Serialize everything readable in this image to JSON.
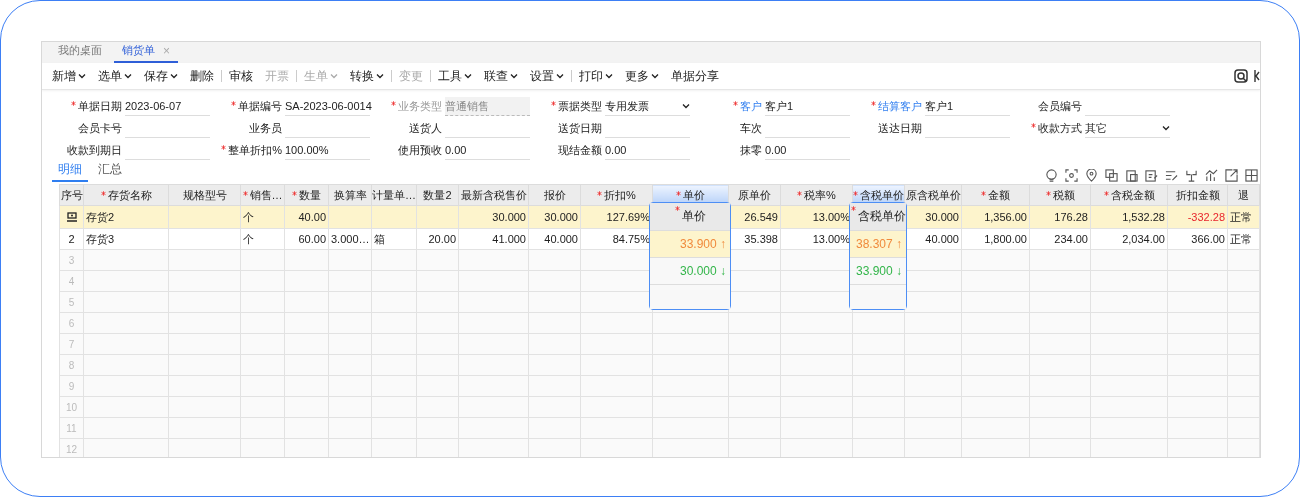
{
  "tabs": [
    {
      "label": "我的桌面",
      "selected": false,
      "closable": false
    },
    {
      "label": "销货单",
      "selected": true,
      "closable": true,
      "close_glyph": "×"
    }
  ],
  "toolbar": [
    {
      "kind": "button",
      "label": "新增",
      "dropdown": true,
      "disabled": false
    },
    {
      "kind": "button",
      "label": "选单",
      "dropdown": true,
      "disabled": false
    },
    {
      "kind": "button",
      "label": "保存",
      "dropdown": true,
      "disabled": false
    },
    {
      "kind": "button",
      "label": "删除",
      "dropdown": false,
      "disabled": false
    },
    {
      "kind": "separator"
    },
    {
      "kind": "button",
      "label": "审核",
      "dropdown": false,
      "disabled": false
    },
    {
      "kind": "button",
      "label": "开票",
      "dropdown": false,
      "disabled": true
    },
    {
      "kind": "separator"
    },
    {
      "kind": "button",
      "label": "生单",
      "dropdown": true,
      "disabled": true
    },
    {
      "kind": "button",
      "label": "转换",
      "dropdown": true,
      "disabled": false
    },
    {
      "kind": "separator"
    },
    {
      "kind": "button",
      "label": "变更",
      "dropdown": false,
      "disabled": true
    },
    {
      "kind": "separator"
    },
    {
      "kind": "button",
      "label": "工具",
      "dropdown": true,
      "disabled": false
    },
    {
      "kind": "button",
      "label": "联查",
      "dropdown": true,
      "disabled": false
    },
    {
      "kind": "button",
      "label": "设置",
      "dropdown": true,
      "disabled": false
    },
    {
      "kind": "separator"
    },
    {
      "kind": "button",
      "label": "打印",
      "dropdown": true,
      "disabled": false
    },
    {
      "kind": "button",
      "label": "更多",
      "dropdown": true,
      "disabled": false
    },
    {
      "kind": "button",
      "label": "单据分享",
      "dropdown": false,
      "disabled": false
    }
  ],
  "form_fields": [
    {
      "label": "单据日期",
      "required": true,
      "link": false,
      "disabled": false,
      "dropdown": false,
      "value": "2023-06-07"
    },
    {
      "label": "单据编号",
      "required": true,
      "link": false,
      "disabled": false,
      "dropdown": false,
      "value": "SA-2023-06-0014"
    },
    {
      "label": "业务类型",
      "required": true,
      "link": false,
      "disabled": true,
      "dropdown": false,
      "value": "普通销售"
    },
    {
      "label": "票据类型",
      "required": true,
      "link": false,
      "disabled": false,
      "dropdown": true,
      "value": "专用发票"
    },
    {
      "label": "客户",
      "required": true,
      "link": true,
      "disabled": false,
      "dropdown": false,
      "value": "客户1"
    },
    {
      "label": "结算客户",
      "required": true,
      "link": true,
      "disabled": false,
      "dropdown": false,
      "value": "客户1"
    },
    {
      "label": "会员编号",
      "required": false,
      "link": false,
      "disabled": false,
      "dropdown": false
    },
    {
      "label": "会员卡号",
      "required": false,
      "link": false,
      "disabled": false,
      "dropdown": false
    },
    {
      "label": "业务员",
      "required": false,
      "link": false,
      "disabled": false,
      "dropdown": false
    },
    {
      "label": "送货人",
      "required": false,
      "link": false,
      "disabled": false,
      "dropdown": false
    },
    {
      "label": "送货日期",
      "required": false,
      "link": false,
      "disabled": false,
      "dropdown": false
    },
    {
      "label": "车次",
      "required": false,
      "link": false,
      "disabled": false,
      "dropdown": false
    },
    {
      "label": "送达日期",
      "required": false,
      "link": false,
      "disabled": false,
      "dropdown": false
    },
    {
      "label": "收款方式",
      "required": true,
      "link": false,
      "disabled": false,
      "dropdown": true,
      "value": "其它"
    },
    {
      "label": "收款到期日",
      "required": false,
      "link": false,
      "disabled": false,
      "dropdown": false
    },
    {
      "label": "整单折扣%",
      "required": true,
      "link": false,
      "disabled": false,
      "dropdown": false,
      "value": "100.00%"
    },
    {
      "label": "使用预收",
      "required": false,
      "link": false,
      "disabled": false,
      "dropdown": false,
      "value": "0.00"
    },
    {
      "label": "现结金额",
      "required": false,
      "link": false,
      "disabled": false,
      "dropdown": false,
      "value": "0.00"
    },
    {
      "label": "抹零",
      "required": false,
      "link": false,
      "disabled": false,
      "dropdown": false,
      "value": "0.00"
    }
  ],
  "detail_tabs": [
    {
      "label": "明细",
      "selected": true
    },
    {
      "label": "汇总",
      "selected": false
    }
  ],
  "table": {
    "columns": [
      {
        "label": "序号",
        "required": false,
        "kind": "index"
      },
      {
        "label": "存货名称",
        "required": true,
        "kind": "text"
      },
      {
        "label": "规格型号",
        "required": false,
        "kind": "text"
      },
      {
        "label": "销售…",
        "required": true,
        "kind": "text"
      },
      {
        "label": "数量",
        "required": true,
        "kind": "number"
      },
      {
        "label": "换算率",
        "required": false,
        "kind": "number"
      },
      {
        "label": "计量单…",
        "required": false,
        "kind": "text"
      },
      {
        "label": "数量2",
        "required": false,
        "kind": "number"
      },
      {
        "label": "最新含税售价",
        "required": false,
        "kind": "number"
      },
      {
        "label": "报价",
        "required": false,
        "kind": "number"
      },
      {
        "label": "折扣%",
        "required": true,
        "kind": "number"
      },
      {
        "label": "单价",
        "required": true,
        "kind": "number",
        "popup": {
          "header": "单价",
          "required": true,
          "values": [
            {
              "text": "33.900",
              "glyph": "↑",
              "rising": true
            },
            {
              "text": "30.000",
              "glyph": "↓",
              "rising": false
            }
          ]
        }
      },
      {
        "label": "原单价",
        "required": false,
        "kind": "number"
      },
      {
        "label": "税率%",
        "required": true,
        "kind": "number"
      },
      {
        "label": "含税单价",
        "required": true,
        "kind": "number",
        "popup": {
          "header": "含税单价",
          "required": true,
          "values": [
            {
              "text": "38.307",
              "glyph": "↑",
              "rising": true
            },
            {
              "text": "33.900",
              "glyph": "↓",
              "rising": false
            }
          ]
        }
      },
      {
        "label": "原含税单价",
        "required": false,
        "kind": "number"
      },
      {
        "label": "金额",
        "required": true,
        "kind": "number"
      },
      {
        "label": "税额",
        "required": true,
        "kind": "number"
      },
      {
        "label": "含税金额",
        "required": true,
        "kind": "number"
      },
      {
        "label": "折扣金额",
        "required": false,
        "kind": "number"
      },
      {
        "label": "退",
        "required": false,
        "kind": "text"
      }
    ],
    "rows": [
      {
        "selected": true,
        "cells": [
          null,
          "存货2",
          null,
          "个",
          "40.00",
          null,
          null,
          null,
          "30.000",
          "30.000",
          "127.69%",
          null,
          "26.549",
          "13.00%",
          null,
          "30.000",
          "1,356.00",
          "176.28",
          "1,532.28",
          {
            "text": "-332.28",
            "negative": true
          },
          "正常"
        ]
      },
      {
        "selected": false,
        "cells": [
          "2",
          "存货3",
          null,
          "个",
          "60.00",
          "3.000…",
          "箱",
          "20.00",
          "41.000",
          "40.000",
          "84.75%",
          null,
          "35.398",
          "13.00%",
          null,
          "40.000",
          "1,800.00",
          "234.00",
          "2,034.00",
          "366.00",
          "正常"
        ]
      }
    ],
    "empty_rows": [
      "3",
      "4",
      "5",
      "6",
      "7",
      "8",
      "9",
      "10",
      "11",
      "12"
    ]
  }
}
